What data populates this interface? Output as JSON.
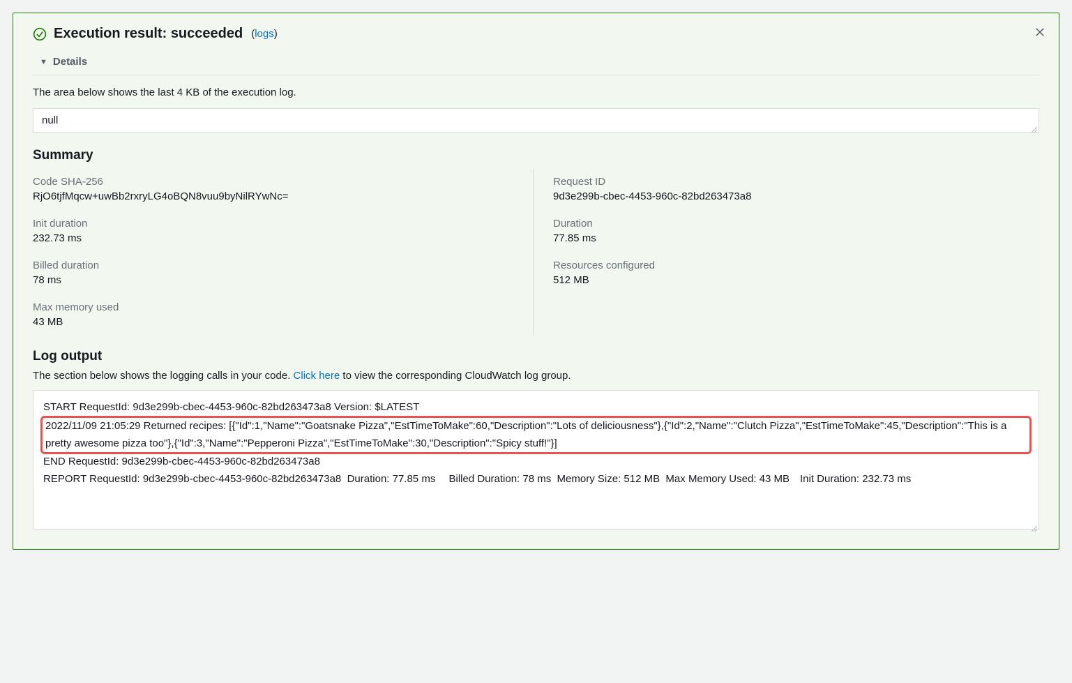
{
  "header": {
    "title": "Execution result: succeeded",
    "logs_link_text": "logs",
    "details_label": "Details"
  },
  "description": "The area below shows the last 4 KB of the execution log.",
  "result_value": "null",
  "summary": {
    "heading": "Summary",
    "left": {
      "sha_label": "Code SHA-256",
      "sha_value": "RjO6tjfMqcw+uwBb2rxryLG4oBQN8vuu9byNilRYwNc=",
      "init_label": "Init duration",
      "init_value": "232.73 ms",
      "billed_label": "Billed duration",
      "billed_value": "78 ms",
      "mem_label": "Max memory used",
      "mem_value": "43 MB"
    },
    "right": {
      "req_label": "Request ID",
      "req_value": "9d3e299b-cbec-4453-960c-82bd263473a8",
      "dur_label": "Duration",
      "dur_value": "77.85 ms",
      "res_label": "Resources configured",
      "res_value": "512 MB"
    }
  },
  "log": {
    "heading": "Log output",
    "desc_pre": "The section below shows the logging calls in your code. ",
    "click_here": "Click here",
    "desc_post": " to view the corresponding CloudWatch log group.",
    "line_start": "START RequestId: 9d3e299b-cbec-4453-960c-82bd263473a8 Version: $LATEST",
    "line_highlight": "2022/11/09 21:05:29 Returned recipes: [{\"Id\":1,\"Name\":\"Goatsnake Pizza\",\"EstTimeToMake\":60,\"Description\":\"Lots of deliciousness\"},{\"Id\":2,\"Name\":\"Clutch Pizza\",\"EstTimeToMake\":45,\"Description\":\"This is a pretty awesome pizza too\"},{\"Id\":3,\"Name\":\"Pepperoni Pizza\",\"EstTimeToMake\":30,\"Description\":\"Spicy stuff!\"}]",
    "line_end": "END RequestId: 9d3e299b-cbec-4453-960c-82bd263473a8",
    "line_report": "REPORT RequestId: 9d3e299b-cbec-4453-960c-82bd263473a8  Duration: 77.85 ms  Billed Duration: 78 ms  Memory Size: 512 MB  Max Memory Used: 43 MB Init Duration: 232.73 ms"
  }
}
